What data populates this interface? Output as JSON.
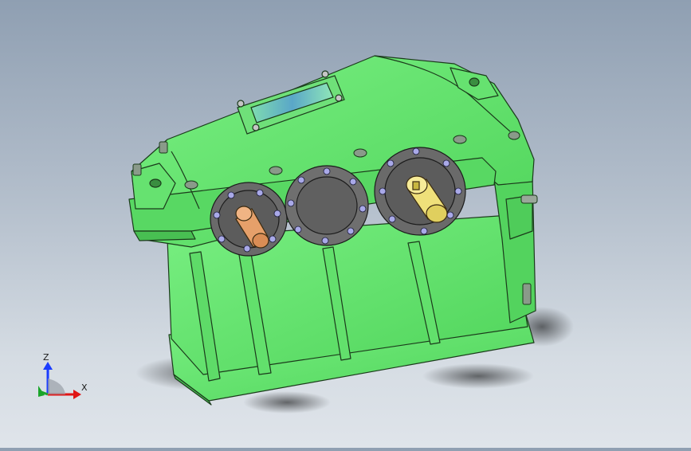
{
  "viewport": {
    "background_top": "#8f9fb2",
    "background_bottom": "#dfe4ea"
  },
  "model": {
    "body_color": "#5fe36a",
    "edge_color": "#1b3a1b",
    "flange_color": "#6b6b6b",
    "bolt_color": "#a9a9e8",
    "input_shaft_color": "#e6a06a",
    "output_shaft_color": "#efe07a",
    "sight_glass_color": "#7ad6a8"
  },
  "triad": {
    "z_label": "Z",
    "x_label": "X",
    "z_color": "#1a3cff",
    "x_color": "#e01515",
    "y_color": "#1aa52a"
  }
}
